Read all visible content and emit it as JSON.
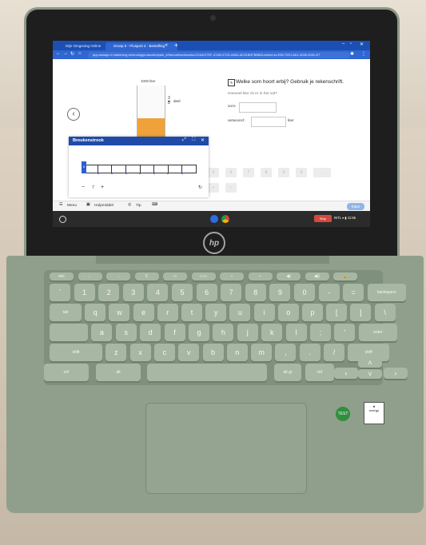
{
  "browser": {
    "tabs": [
      {
        "title": "Mijn Omgeving Online",
        "active": false
      },
      {
        "title": "Groep 6 - Plusport 4 - Bestelling",
        "active": true
      }
    ],
    "url": "app.wiswijs.nl  malmberg.nl/rending/productie/ipa/k_6/thema/fractions/ks:DXAKO7EF-47AB-472D-A654-AD31BDFBB851/select-ks:EBC72E1-8A1-4035-9091-E7"
  },
  "exercise": {
    "beaker_capacity": "1000 liter",
    "beaker_fraction_num": "3",
    "beaker_fraction_den": "8",
    "beaker_fraction_unit": "deel",
    "beaker_fill_level": 0.375,
    "question": "Welke som hoort erbij? Gebruik je rekenschrift.",
    "subquestion": "Hoeveel liter zit er in het vat?",
    "som_label": "som:",
    "antwoord_label": "antwoord:",
    "antwoord_unit": "liter",
    "prev_icon": "chevron-left-icon"
  },
  "strip_dialog": {
    "title": "Breukenstrook",
    "segments": 8,
    "count": "7",
    "minus": "−",
    "plus": "+",
    "marker": "0"
  },
  "keypad": {
    "row1": [
      "5",
      "6",
      "7",
      "8",
      "9",
      "0",
      ","
    ],
    "row2": [
      "+",
      "−"
    ]
  },
  "toolbar": {
    "menu": "Menu",
    "help": "Hulpmiddel",
    "tip": "Tip",
    "done": "Klaar"
  },
  "shelf": {
    "red_button": "Stop",
    "tray": "INTL ▾ ▮ 11:55"
  },
  "laptop": {
    "brand": "hp",
    "sticker": "TEST"
  },
  "keyboard": {
    "fn_row": [
      "esc",
      "←",
      "→",
      "C",
      "▭",
      "▭▭",
      "○",
      "☼",
      "◀)",
      "◀))",
      "🔒"
    ],
    "row1": [
      "`",
      "1",
      "2",
      "3",
      "4",
      "5",
      "6",
      "7",
      "8",
      "9",
      "0",
      "-",
      "=",
      "backspace"
    ],
    "row2": [
      "tab",
      "q",
      "w",
      "e",
      "r",
      "t",
      "y",
      "u",
      "i",
      "o",
      "p",
      "[",
      "]",
      "\\"
    ],
    "row3": [
      "",
      "a",
      "s",
      "d",
      "f",
      "g",
      "h",
      "j",
      "k",
      "l",
      ";",
      "'",
      "enter"
    ],
    "row4": [
      "shift",
      "z",
      "x",
      "c",
      "v",
      "b",
      "n",
      "m",
      ",",
      ".",
      "/",
      "shift"
    ],
    "row5": [
      "ctrl",
      "alt",
      "",
      "alt gr",
      "ctrl"
    ],
    "arrows": [
      "‹",
      "˄",
      "˅",
      "›"
    ]
  }
}
